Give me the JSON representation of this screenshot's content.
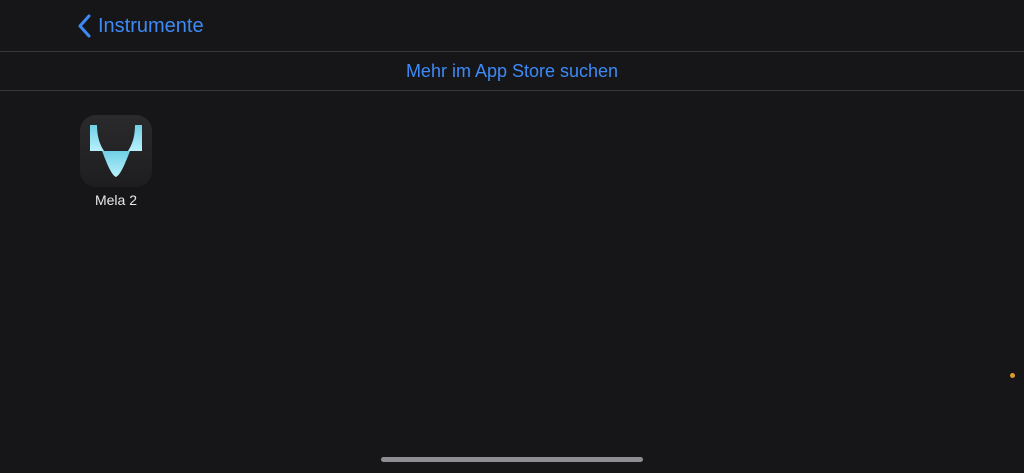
{
  "nav": {
    "back_label": "Instrumente",
    "back_icon": "chevron-left-icon"
  },
  "store_bar": {
    "link_label": "Mehr im App Store suchen"
  },
  "apps": [
    {
      "name": "Mela 2",
      "icon": "mela-wave-icon"
    }
  ],
  "colors": {
    "accent": "#3d8af7",
    "background": "#161618",
    "separator": "#38383a",
    "status_dot": "#e09a2c"
  }
}
